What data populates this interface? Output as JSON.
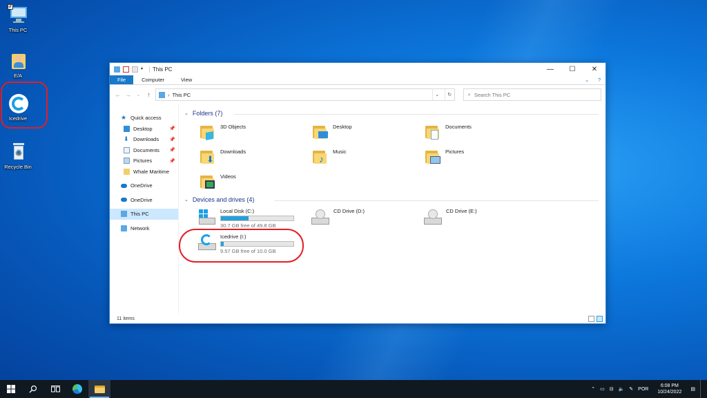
{
  "desktop": {
    "icons": [
      {
        "label": "This PC"
      },
      {
        "label": "E/A"
      },
      {
        "label": "Icedrive"
      },
      {
        "label": "Recycle Bin"
      }
    ]
  },
  "explorer": {
    "title": "This PC",
    "ribbon_tabs": [
      "File",
      "Computer",
      "View"
    ],
    "address": {
      "path_label": "This PC"
    },
    "search": {
      "placeholder": "Search This PC"
    },
    "nav": {
      "quick_access": "Quick access",
      "items": [
        "Desktop",
        "Downloads",
        "Documents",
        "Pictures",
        "Whale Maritime"
      ],
      "onedrive_1": "OneDrive",
      "onedrive_2": "OneDrive",
      "this_pc": "This PC",
      "network": "Network"
    },
    "folders_header": "Folders (7)",
    "folders": [
      "3D Objects",
      "Desktop",
      "Documents",
      "Downloads",
      "Music",
      "Pictures",
      "Videos"
    ],
    "drives_header": "Devices and drives (4)",
    "drives": [
      {
        "name": "Local Disk (C:)",
        "free": "30.7 GB free of 49.8 GB",
        "used_fraction": 0.38
      },
      {
        "name": "CD Drive (D:)"
      },
      {
        "name": "CD Drive (E:)"
      },
      {
        "name": "Icedrive (I:)",
        "free": "9.57 GB free of 10.0 GB",
        "used_fraction": 0.04
      }
    ],
    "status": "11 items"
  },
  "taskbar": {
    "lang": "POR",
    "time": "6:08 PM",
    "date": "10/24/2022"
  },
  "colors": {
    "accent": "#1979ca",
    "bar_fill": "#26a0da",
    "highlight": "#e21e27"
  }
}
